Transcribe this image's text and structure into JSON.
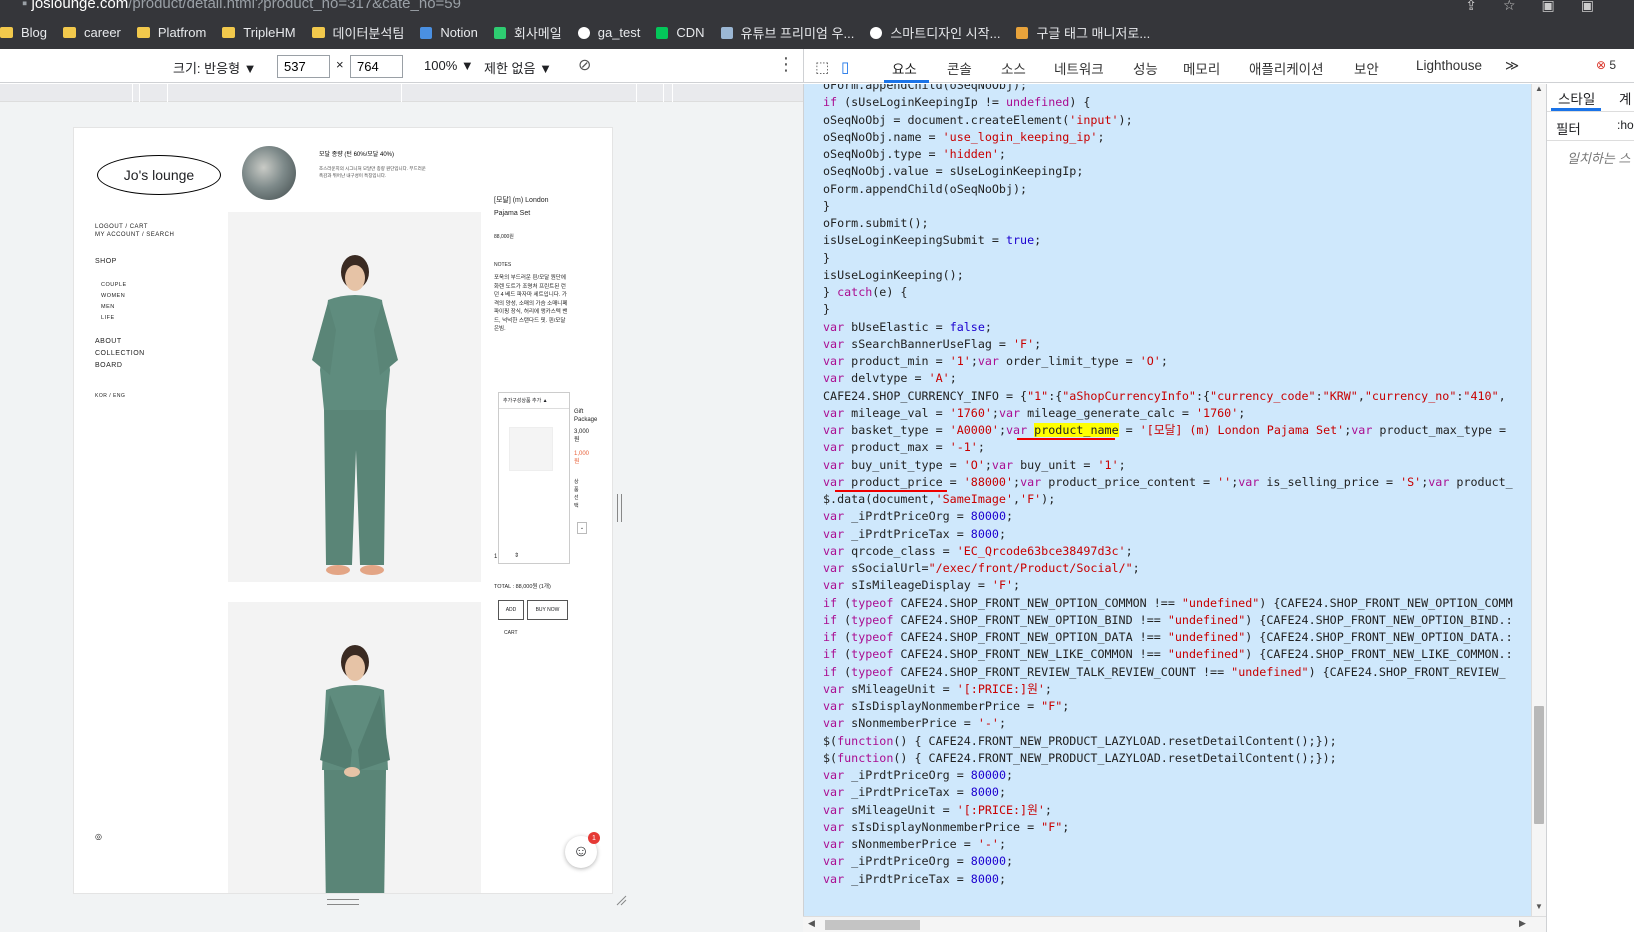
{
  "browser": {
    "url_host": "joslounge.com",
    "url_path": "/product/detail.html?product_no=317&cate_no=59",
    "bookmarks": [
      {
        "label": "Blog",
        "icon": "folder-icon",
        "color": "#f2c94c"
      },
      {
        "label": "career",
        "icon": "folder-icon",
        "color": "#f2c94c"
      },
      {
        "label": "Platfrom",
        "icon": "folder-icon",
        "color": "#f2c94c"
      },
      {
        "label": "TripleHM",
        "icon": "folder-icon",
        "color": "#f2c94c"
      },
      {
        "label": "데이터분석팀",
        "icon": "folder-icon",
        "color": "#f2c94c"
      },
      {
        "label": "Notion",
        "icon": "monitor-icon",
        "color": "#4a90e2"
      },
      {
        "label": "회사메일",
        "icon": "mail-icon",
        "color": "#2ecc71"
      },
      {
        "label": "ga_test",
        "icon": "globe-icon",
        "color": "#ffffff"
      },
      {
        "label": "CDN",
        "icon": "naver-icon",
        "color": "#03c75a"
      },
      {
        "label": "유튜브 프리미엄 우...",
        "icon": "wordpress-icon",
        "color": "#9bb7d4"
      },
      {
        "label": "스마트디자인 시작...",
        "icon": "globe-icon",
        "color": "#ffffff"
      },
      {
        "label": "구글 태그 매니저로...",
        "icon": "bookmark-icon",
        "color": "#e8a33b"
      }
    ]
  },
  "device_toolbar": {
    "size_label": "크기: 반응형 ▼",
    "width": "537",
    "height": "764",
    "times": "×",
    "zoom": "100% ▼",
    "throttle": "제한 없음 ▼"
  },
  "site": {
    "logo": "Jo's lounge",
    "promo_title": "모달 종량 (턴 60%/모달 40%)",
    "promo_sub": "조스라운지의 시그니처 모달만 종량 원단입니다. 부드러운 촉감과 뛰어난 내구성이 특징입니다.",
    "nav_account": [
      "LOGOUT / CART",
      "MY ACCOUNT / SEARCH"
    ],
    "nav_shop": "SHOP",
    "nav_shop_sub": [
      "COUPLE",
      "WOMEN",
      "MEN",
      "LIFE"
    ],
    "nav_main": [
      "ABOUT",
      "COLLECTION",
      "BOARD"
    ],
    "nav_lang": "KOR / ENG",
    "product_name": "[모달] (m) London Pajama Set",
    "price": "88,000원",
    "notes_label": "NOTES",
    "notes_text": "포욱의 부드러운 핀/모달 원단에 화렌 도트가 조명처 프린트된 런던 4 베드 파자마 세트입니다. 가격의 양성, 소매의 가슴 소매니페 파이핑 장식, 허리에 앵카스텍 밴드, 넉넉한 스탠다드 핏. 핀/모달 은빔.",
    "option_header": "추가구성상품 추가 ▲",
    "gift_name": "Gift Package",
    "gift_price": "3,000원",
    "gift_sale": "1,000원",
    "gift_select": "상품선택",
    "qty": "1",
    "total": "TOTAL : 88,000원 (1개)",
    "btn_add": "ADD",
    "btn_buy": "BUY NOW",
    "btn_cart": "CART",
    "chat_badge": "1"
  },
  "devtools": {
    "tabs": [
      "요소",
      "콘솔",
      "소스",
      "네트워크",
      "성능",
      "메모리",
      "애플리케이션",
      "보안",
      "Lighthouse",
      "≫"
    ],
    "error_count": "5",
    "styles_tabs": [
      "스타일",
      "계"
    ],
    "filter_label": "필터",
    "hov": ":ho",
    "no_match": "일치하는 스"
  },
  "code_lines": [
    "oForm.appendChild(oSeqNoObj);",
    "if (sUseLoginKeepingIp != undefined) {",
    "oSeqNoObj = document.createElement('input');",
    "oSeqNoObj.name = 'use_login_keeping_ip';",
    "oSeqNoObj.type = 'hidden';",
    "oSeqNoObj.value = sUseLoginKeepingIp;",
    "oForm.appendChild(oSeqNoObj);",
    "}",
    "oForm.submit();",
    "isUseLoginKeepingSubmit = true;",
    "}",
    "isUseLoginKeeping();",
    "} catch(e) {",
    "}",
    "var bUseElastic = false;",
    "var sSearchBannerUseFlag = 'F';",
    "var product_min = '1';var order_limit_type = 'O';",
    "var delvtype = 'A';",
    "CAFE24.SHOP_CURRENCY_INFO = {\"1\":{\"aShopCurrencyInfo\":{\"currency_code\":\"KRW\",\"currency_no\":\"410\",",
    "var mileage_val = '1760';var mileage_generate_calc = '1760';",
    "var basket_type = 'A0000';var product_name = '[모달] (m) London Pajama Set';var product_max_type =",
    "var product_max = '-1';",
    "var buy_unit_type = 'O';var buy_unit = '1';",
    "var product_price = '88000';var product_price_content = '';var is_selling_price = 'S';var product_",
    "$.data(document,'SameImage','F');",
    "var _iPrdtPriceOrg = 80000;",
    "var _iPrdtPriceTax = 8000;",
    "var qrcode_class = 'EC_Qrcode63bce38497d3c';",
    "var sSocialUrl=\"/exec/front/Product/Social/\";",
    "var sIsMileageDisplay = 'F';",
    "if (typeof CAFE24.SHOP_FRONT_NEW_OPTION_COMMON !== \"undefined\") {CAFE24.SHOP_FRONT_NEW_OPTION_COMM",
    "if (typeof CAFE24.SHOP_FRONT_NEW_OPTION_BIND !== \"undefined\") {CAFE24.SHOP_FRONT_NEW_OPTION_BIND.:",
    "if (typeof CAFE24.SHOP_FRONT_NEW_OPTION_DATA !== \"undefined\") {CAFE24.SHOP_FRONT_NEW_OPTION_DATA.:",
    "if (typeof CAFE24.SHOP_FRONT_NEW_LIKE_COMMON !== \"undefined\") {CAFE24.SHOP_FRONT_NEW_LIKE_COMMON.:",
    "if (typeof CAFE24.SHOP_FRONT_REVIEW_TALK_REVIEW_COUNT !== \"undefined\") {CAFE24.SHOP_FRONT_REVIEW_",
    "var sMileageUnit = '[:PRICE:]원';",
    "var sIsDisplayNonmemberPrice = \"F\";",
    "var sNonmemberPrice = '-';",
    "$(function() { CAFE24.FRONT_NEW_PRODUCT_LAZYLOAD.resetDetailContent();});",
    "$(function() { CAFE24.FRONT_NEW_PRODUCT_LAZYLOAD.resetDetailContent();});",
    "var _iPrdtPriceOrg = 80000;",
    "var _iPrdtPriceTax = 8000;",
    "var sMileageUnit = '[:PRICE:]원';",
    "var sIsDisplayNonmemberPrice = \"F\";",
    "var sNonmemberPrice = '-';",
    "var _iPrdtPriceOrg = 80000;",
    "var _iPrdtPriceTax = 8000;"
  ],
  "highlight_word": "product_name",
  "colors": {
    "selection_bg": "#cfe8fc",
    "keyword": "#aa0d91",
    "string": "#c80000",
    "number": "#1c00cf",
    "annotation": "#e00000"
  }
}
